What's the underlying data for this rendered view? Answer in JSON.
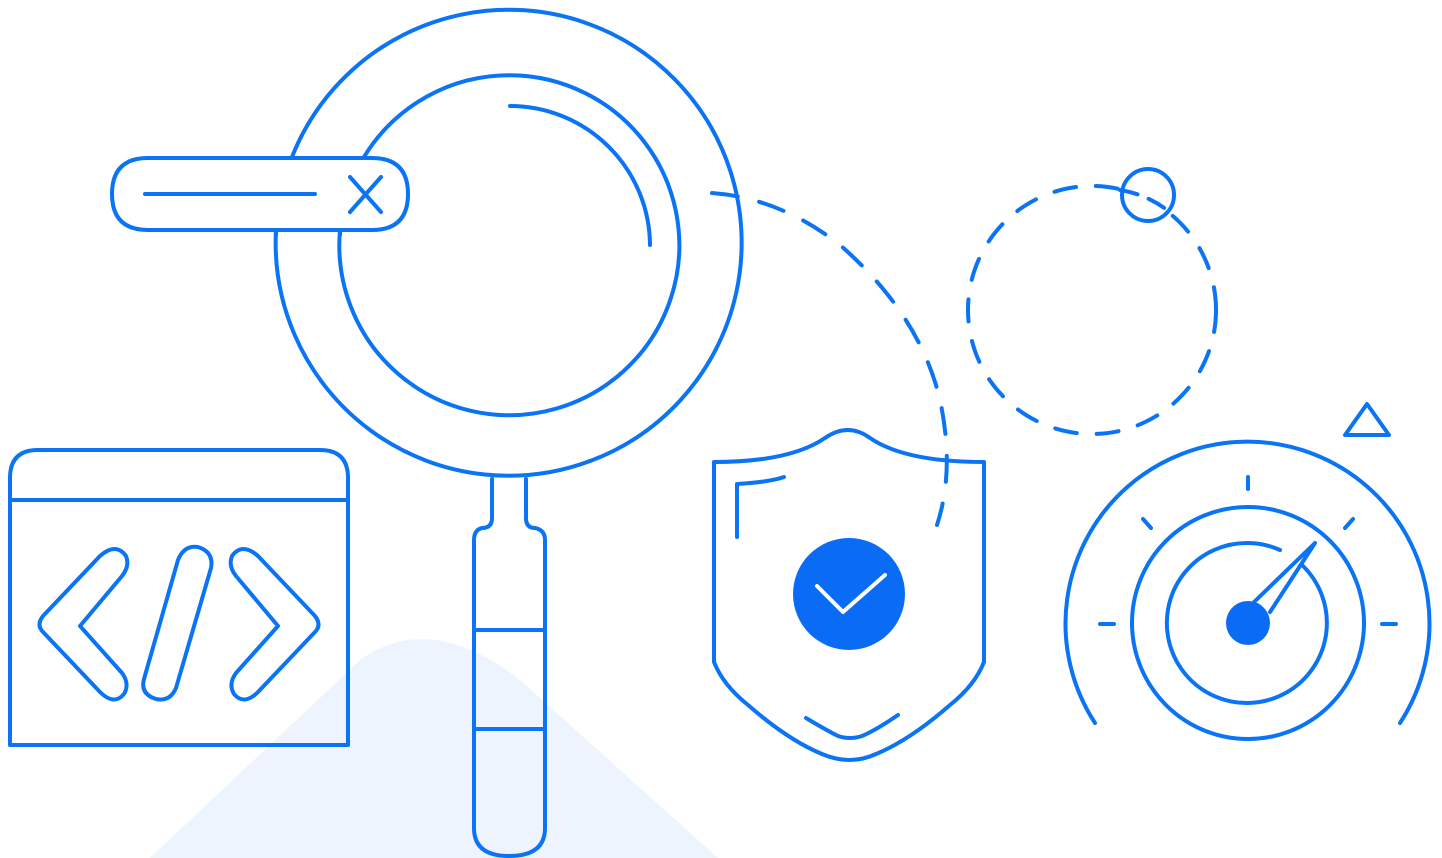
{
  "illustration": {
    "colors": {
      "accent": "#0A74F5",
      "fill": "#0A6CF5",
      "background": "#FFFFFF",
      "bg_shape": "#EEF4FE"
    },
    "icons": [
      "code-window-icon",
      "magnifying-glass-icon",
      "search-bar-icon",
      "clear-x-icon",
      "shield-check-icon",
      "dashed-orbit-icon",
      "speedometer-gauge-icon",
      "warning-triangle-icon"
    ]
  }
}
